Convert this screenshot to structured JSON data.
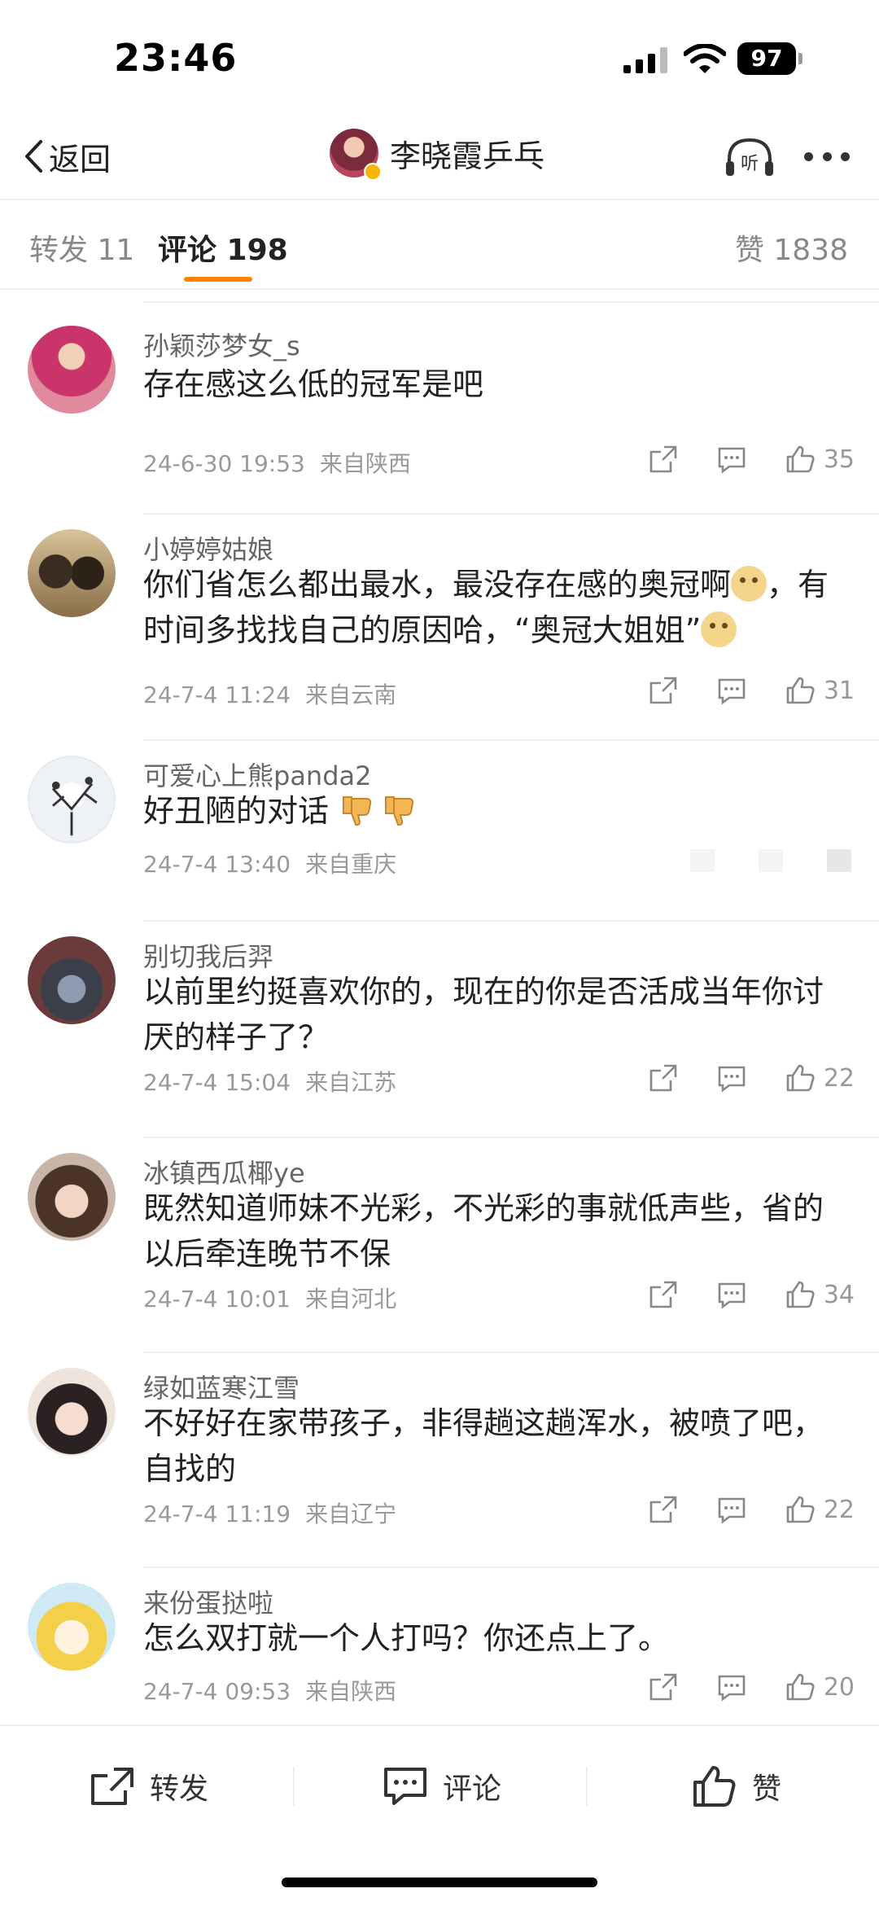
{
  "status_bar": {
    "time": "23:46",
    "battery": "97"
  },
  "nav": {
    "back_label": "返回",
    "title": "李晓霞乒乓",
    "listen_label": "听"
  },
  "tabs": {
    "repost": "转发 11",
    "comments": "评论 198",
    "likes": "赞 1838"
  },
  "comments": [
    {
      "user": "孙颖莎梦女_s",
      "text": "存在感这么低的冠军是吧",
      "date": "24-6-30 19:53",
      "location": "来自陕西",
      "likes": "35"
    },
    {
      "user": "小婷婷姑娘",
      "text_parts": [
        "你们省怎么都出最水，最没存在感的奥冠啊",
        "，有时间多找找自己的原因哈，“奥冠大姐姐”"
      ],
      "date": "24-7-4 11:24",
      "location": "来自云南",
      "likes": "31"
    },
    {
      "user": "可爱心上熊panda2",
      "text": "好丑陋的对话",
      "date": "24-7-4 13:40",
      "location": "来自重庆",
      "likes": ""
    },
    {
      "user": "别切我后羿",
      "text": "以前里约挺喜欢你的，现在的你是否活成当年你讨厌的样子了？",
      "date": "24-7-4 15:04",
      "location": "来自江苏",
      "likes": "22"
    },
    {
      "user": "冰镇西瓜椰ye",
      "text": "既然知道师妹不光彩，不光彩的事就低声些，省的以后牵连晚节不保",
      "date": "24-7-4 10:01",
      "location": "来自河北",
      "likes": "34"
    },
    {
      "user": "绿如蓝寒江雪",
      "text": "不好好在家带孩子，非得趟这趟浑水，被喷了吧，自找的",
      "date": "24-7-4 11:19",
      "location": "来自辽宁",
      "likes": "22"
    },
    {
      "user": "来份蛋挞啦",
      "text": "怎么双打就一个人打吗？你还点上了。",
      "date": "24-7-4 09:53",
      "location": "来自陕西",
      "likes": "20"
    }
  ],
  "bottom_bar": {
    "repost": "转发",
    "comment": "评论",
    "like": "赞"
  },
  "colors": {
    "accent": "#ff8200",
    "meta_text": "#999999",
    "username": "#666666"
  }
}
